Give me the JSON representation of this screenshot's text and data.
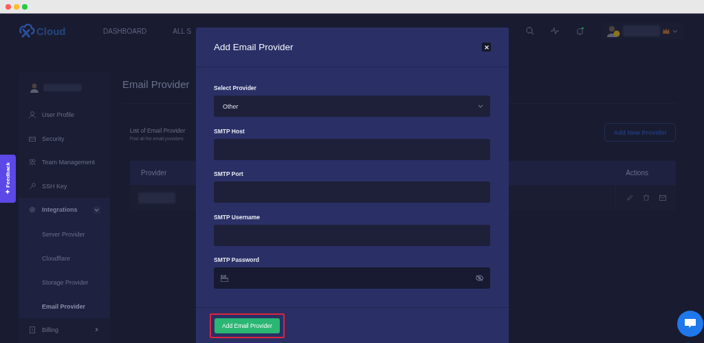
{
  "header": {
    "logo": "Cloud",
    "nav": [
      {
        "label": "DASHBOARD"
      },
      {
        "label": "ALL S"
      }
    ]
  },
  "sidebar": {
    "items": [
      {
        "label": "User Profile"
      },
      {
        "label": "Security"
      },
      {
        "label": "Team Management"
      },
      {
        "label": "SSH Key"
      },
      {
        "label": "Integrations",
        "expanded": true,
        "children": [
          {
            "label": "Server Provider",
            "selected": false
          },
          {
            "label": "Cloudflare",
            "selected": false
          },
          {
            "label": "Storage Provider",
            "selected": false
          },
          {
            "label": "Email Provider",
            "selected": true
          }
        ]
      },
      {
        "label": "Billing",
        "expanded": false
      }
    ]
  },
  "main": {
    "title": "Email Provider",
    "list_title": "List of Email Provider",
    "list_subtitle": "Find all the email providers",
    "add_button": "Add New Provider",
    "table": {
      "columns": [
        "Provider",
        "Actions"
      ]
    }
  },
  "feedback": {
    "label": "Feedback"
  },
  "modal": {
    "title": "Add Email Provider",
    "fields": [
      {
        "label": "Select Provider",
        "kind": "select",
        "value": "Other"
      },
      {
        "label": "SMTP Host",
        "kind": "text"
      },
      {
        "label": "SMTP Port",
        "kind": "text"
      },
      {
        "label": "SMTP Username",
        "kind": "text"
      },
      {
        "label": "SMTP Password",
        "kind": "password"
      }
    ],
    "submit": {
      "label": "Add Email Provider",
      "highlighted": true
    }
  }
}
